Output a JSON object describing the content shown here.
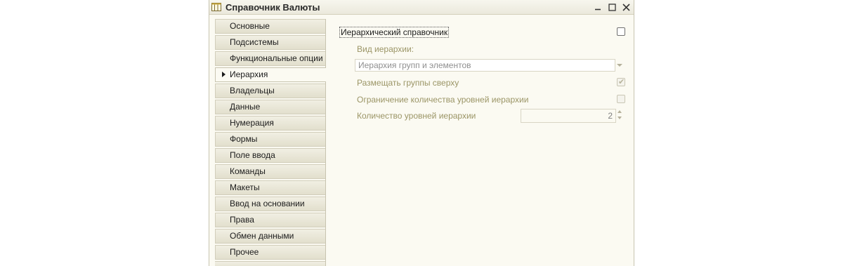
{
  "window": {
    "title": "Справочник Валюты",
    "icon": "table-icon"
  },
  "sidebar": {
    "items": [
      {
        "label": "Основные",
        "active": false
      },
      {
        "label": "Подсистемы",
        "active": false
      },
      {
        "label": "Функциональные опции",
        "active": false
      },
      {
        "label": "Иерархия",
        "active": true
      },
      {
        "label": "Владельцы",
        "active": false
      },
      {
        "label": "Данные",
        "active": false
      },
      {
        "label": "Нумерация",
        "active": false
      },
      {
        "label": "Формы",
        "active": false
      },
      {
        "label": "Поле ввода",
        "active": false
      },
      {
        "label": "Команды",
        "active": false
      },
      {
        "label": "Макеты",
        "active": false
      },
      {
        "label": "Ввод на основании",
        "active": false
      },
      {
        "label": "Права",
        "active": false
      },
      {
        "label": "Обмен данными",
        "active": false
      },
      {
        "label": "Прочее",
        "active": false
      }
    ]
  },
  "hierarchy": {
    "hierarchical_label": "Иерархический справочник",
    "hierarchical_checked": false,
    "kind_label": "Вид иерархии:",
    "kind_value": "Иерархия групп и элементов",
    "groups_on_top_label": "Размещать группы сверху",
    "groups_on_top_checked": true,
    "limit_levels_label": "Ограничение количества уровней иерархии",
    "limit_levels_checked": false,
    "levels_count_label": "Количество уровней иерархии",
    "levels_count_value": "2"
  },
  "colors": {
    "background": "#fbfaf2",
    "disabled_text": "#9b9566",
    "tab_gradient_top": "#f1efe3",
    "tab_gradient_bottom": "#e2dfcd"
  }
}
